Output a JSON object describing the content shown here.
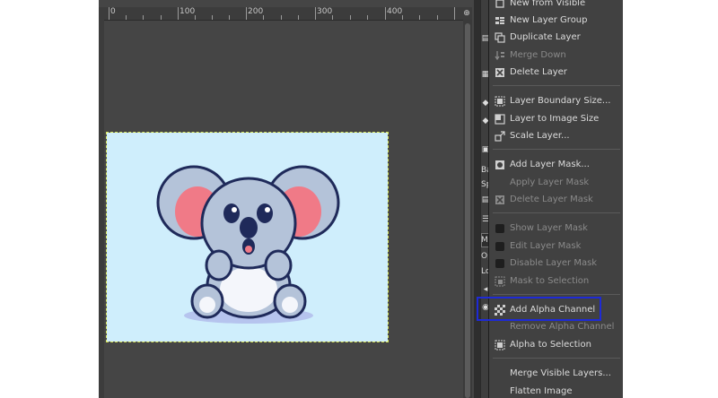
{
  "ruler": {
    "labels": [
      "0",
      "100",
      "200",
      "300",
      "400"
    ],
    "corner": "⊕"
  },
  "canvas": {
    "background": "#cfeefc",
    "image": "koala cartoon"
  },
  "layers_panel": {
    "fragments": [
      "Ba",
      "Sp",
      "M",
      "Op",
      "Lo"
    ]
  },
  "menu": {
    "items": [
      {
        "label": "New from Visible",
        "icon": "new-from-visible-icon",
        "enabled": true
      },
      {
        "label": "New Layer Group",
        "icon": "layer-group-icon",
        "enabled": true
      },
      {
        "label": "Duplicate Layer",
        "icon": "duplicate-icon",
        "enabled": true
      },
      {
        "label": "Merge Down",
        "icon": "merge-down-icon",
        "enabled": false
      },
      {
        "label": "Delete Layer",
        "icon": "delete-icon",
        "enabled": true
      },
      {
        "label": "Layer Boundary Size...",
        "icon": "boundary-icon",
        "enabled": true
      },
      {
        "label": "Layer to Image Size",
        "icon": "layer-to-image-icon",
        "enabled": true
      },
      {
        "label": "Scale Layer...",
        "icon": "scale-icon",
        "enabled": true
      },
      {
        "label": "Add Layer Mask...",
        "icon": "add-mask-icon",
        "enabled": true
      },
      {
        "label": "Apply Layer Mask",
        "icon": "",
        "enabled": false
      },
      {
        "label": "Delete Layer Mask",
        "icon": "delete-mask-icon",
        "enabled": false
      },
      {
        "label": "Show Layer Mask",
        "icon": "checkbox-icon",
        "enabled": false
      },
      {
        "label": "Edit Layer Mask",
        "icon": "checkbox-icon",
        "enabled": false
      },
      {
        "label": "Disable Layer Mask",
        "icon": "checkbox-icon",
        "enabled": false
      },
      {
        "label": "Mask to Selection",
        "icon": "mask-to-selection-icon",
        "enabled": false
      },
      {
        "label": "Add Alpha Channel",
        "icon": "alpha-icon",
        "enabled": true,
        "highlighted": true
      },
      {
        "label": "Remove Alpha Channel",
        "icon": "",
        "enabled": false
      },
      {
        "label": "Alpha to Selection",
        "icon": "alpha-to-selection-icon",
        "enabled": true
      },
      {
        "label": "Merge Visible Layers...",
        "icon": "",
        "enabled": true
      },
      {
        "label": "Flatten Image",
        "icon": "",
        "enabled": true
      }
    ]
  },
  "colors": {
    "highlight_border": "#1e2ad6",
    "menu_bg": "#414141",
    "canvas_bg": "#454545"
  }
}
